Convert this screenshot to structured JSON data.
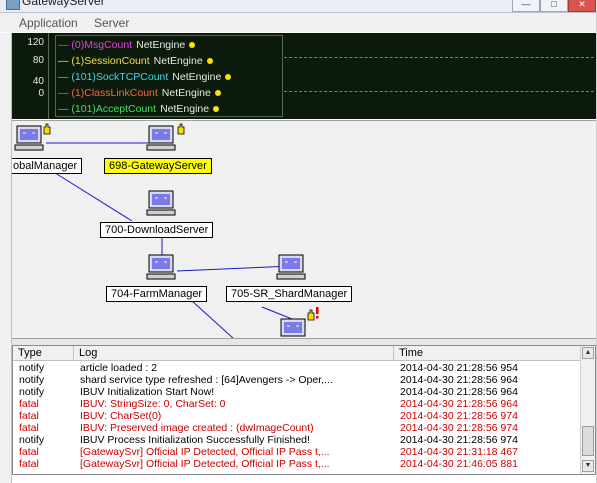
{
  "window": {
    "title": "GatewayServer",
    "icon": "app-window-icon"
  },
  "menu": {
    "items": [
      "Application",
      "Server"
    ]
  },
  "graph": {
    "y_ticks": [
      "120",
      "80",
      "40",
      "0"
    ],
    "series": [
      {
        "label": "(0)MsgCount",
        "engine": "NetEngine",
        "color": "#e040e0"
      },
      {
        "label": "(1)SessionCount",
        "engine": "NetEngine",
        "color": "#f0e040"
      },
      {
        "label": "(101)SockTCPCount",
        "engine": "NetEngine",
        "color": "#40d8e8"
      },
      {
        "label": "(1)ClassLinkCount",
        "engine": "NetEngine",
        "color": "#f06a4a"
      },
      {
        "label": "(101)AcceptCount",
        "engine": "NetEngine",
        "color": "#40e060"
      }
    ]
  },
  "topology": {
    "nodes": [
      {
        "label": "obalManager",
        "selected": false
      },
      {
        "label": "698-GatewayServer",
        "selected": true
      },
      {
        "label": "700-DownloadServer",
        "selected": false
      },
      {
        "label": "704-FarmManager",
        "selected": false
      },
      {
        "label": "705-SR_ShardManager",
        "selected": false
      }
    ]
  },
  "log": {
    "columns": [
      "Type",
      "Log",
      "Time"
    ],
    "rows": [
      {
        "type": "notify",
        "log": "article loaded : 2",
        "time": "2014-04-30 21:28:56 954"
      },
      {
        "type": "notify",
        "log": "shard service type refreshed : [64]Avengers -> Oper,...",
        "time": "2014-04-30 21:28:56 964"
      },
      {
        "type": "notify",
        "log": "IBUV Initialization Start Now!",
        "time": "2014-04-30 21:28:56 964"
      },
      {
        "type": "fatal",
        "log": "IBUV: StringSize: 0, CharSet: 0",
        "time": "2014-04-30 21:28:56 964"
      },
      {
        "type": "fatal",
        "log": "IBUV: CharSet(0)",
        "time": "2014-04-30 21:28:56 974"
      },
      {
        "type": "fatal",
        "log": "IBUV: Preserved image created : (dwImageCount)",
        "time": "2014-04-30 21:28:56 974"
      },
      {
        "type": "notify",
        "log": "IBUV Process Initialization Successfully Finished!",
        "time": "2014-04-30 21:28:56 974"
      },
      {
        "type": "fatal",
        "log": "[GatewaySvr] Official IP Detected, Official IP Pass t,...",
        "time": "2014-04-30 21:31:18 467"
      },
      {
        "type": "fatal",
        "log": "[GatewaySvr] Official IP Detected, Official IP Pass t,...",
        "time": "2014-04-30 21:46:05 881"
      }
    ]
  },
  "colors": {
    "fatal": "#cc0000",
    "notify": "#000000",
    "selected_node": "#ffff00",
    "graph_bg": "#0c1a0c"
  }
}
